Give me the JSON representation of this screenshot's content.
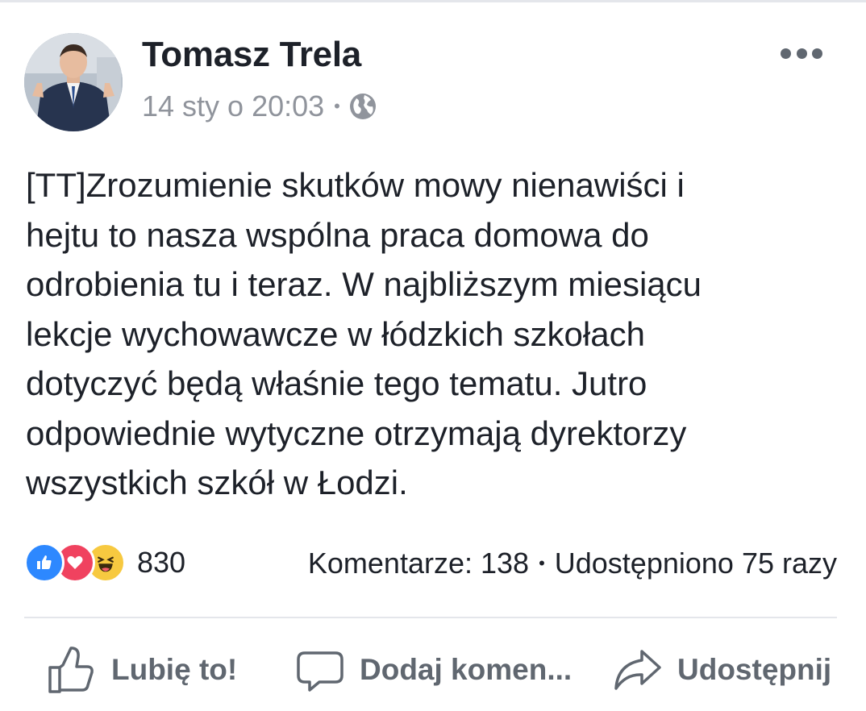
{
  "author": {
    "name": "Tomasz Trela",
    "timestamp": "14 sty o 20:03",
    "privacy_icon": "globe-icon"
  },
  "post": {
    "text": "[TT]Zrozumienie skutków mowy nienawiści i\nhejtu to nasza wspólna praca domowa do\nodrobienia tu i teraz. W najbliższym miesiącu\nlekcje wychowawcze w łódzkich szkołach\ndotyczyć będą właśnie tego tematu. Jutro\nodpowiednie wytyczne otrzymają dyrektorzy\nwszystkich szkół w Łodzi."
  },
  "engagement": {
    "reaction_icons": [
      "like-icon",
      "love-icon",
      "haha-icon"
    ],
    "reaction_count": "830",
    "comments": "Komentarze: 138",
    "shares": "Udostępniono 75 razy"
  },
  "actions": {
    "like_label": "Lubię to!",
    "comment_label": "Dodaj komen...",
    "share_label": "Udostępnij"
  },
  "colors": {
    "like": "#2d88ff",
    "love": "#f0425f",
    "haha": "#f7c940",
    "text": "#1d2129",
    "secondary": "#90949c",
    "action": "#606770"
  }
}
